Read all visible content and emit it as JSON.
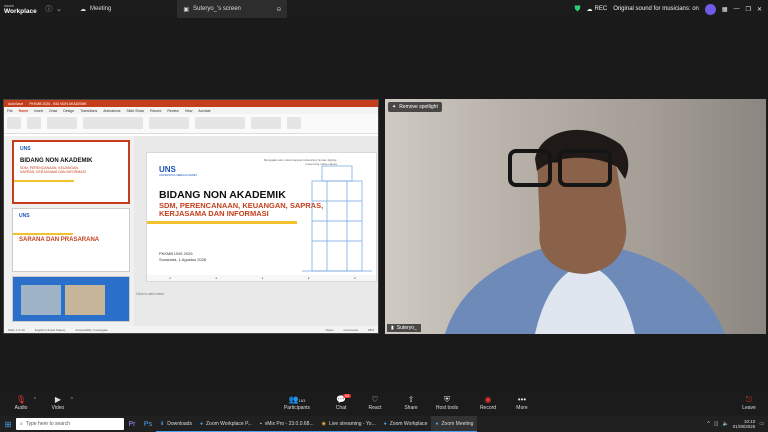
{
  "topbar": {
    "logo_line1": "zoom",
    "logo_line2": "Workplace",
    "tab_meeting": "Meeting",
    "tab_screen": "Suteryo_'s screen",
    "rec_label": "REC",
    "sound_label": "Original sound for musicians: on"
  },
  "slides": {
    "thumb1_title": "BIDANG NON AKADEMIK",
    "thumb1_sub": "SDM, PERENCANAAN, KEUANGAN, SAPRAS, KERJASAMA DAN INFORMASI",
    "thumb2_title": "SARANA DAN PRASARANA",
    "main_logo": "UNS",
    "main_logo_sub": "UNIVERSITAS SEBELAS MARET",
    "main_tagline": "Mengajak satu untuk bangsa Advancing human dignity, preserving noble values",
    "main_title": "BIDANG NON AKADEMIK",
    "main_sub": "SDM, PERENCANAAN, KEUANGAN, SAPRAS, KERJASAMA DAN INFORMASI",
    "main_event": "PKKMB UNS 2026",
    "main_date": "Surakarta, 1 Agustus 2026",
    "notes_placeholder": "Click to add notes",
    "status_left": "Slide 1 of 19",
    "status_lang": "English (United States)",
    "status_access": "Accessibility: Investigate",
    "status_notes": "Notes",
    "status_comments": "Comments",
    "status_zoom": "98%"
  },
  "ppt_menu": [
    "File",
    "Home",
    "Insert",
    "Draw",
    "Design",
    "Transitions",
    "Animations",
    "Slide Show",
    "Record",
    "Review",
    "View",
    "Acrobat"
  ],
  "video": {
    "remove_spotlight": "Remove spotlight",
    "participant_name": "Suteryo_"
  },
  "toolbar": {
    "audio": "Audio",
    "video": "Video",
    "participants": "Participants",
    "participants_count": "163",
    "chat": "Chat",
    "chat_badge": "63",
    "react": "React",
    "share": "Share",
    "host_tools": "Host tools",
    "record": "Record",
    "more": "More",
    "leave": "Leave"
  },
  "taskbar": {
    "search_placeholder": "Type here to search",
    "tasks": [
      "Downloads",
      "Zoom Workplace P...",
      "vMix Pro - 23.0.0.68...",
      "Live streaming - Yo...",
      "Zoom Workplace",
      "Zoom Meeting"
    ],
    "time": "10:10",
    "date": "01/08/2026"
  },
  "colors": {
    "ppt_accent": "#c43e1c",
    "uns_blue": "#1a56b8",
    "uns_yellow": "#f2c12e",
    "zoom_red": "#e33333",
    "taskbar_accent": "#4aa3f0"
  }
}
